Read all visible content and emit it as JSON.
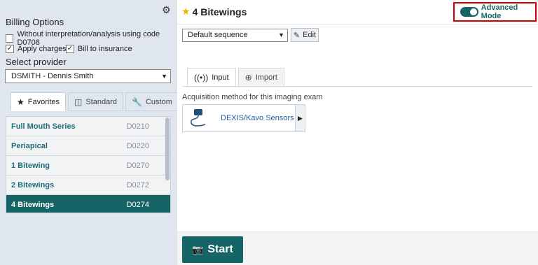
{
  "left": {
    "billing_title": "Billing Options",
    "no_interp_label": "Without interpretation/analysis using code D0708",
    "no_interp_checked": false,
    "apply_charges_label": "Apply charges",
    "apply_charges_checked": true,
    "bill_insurance_label": "Bill to insurance",
    "bill_insurance_checked": true,
    "select_provider_title": "Select provider",
    "provider_value": "DSMITH - Dennis Smith",
    "tabs": [
      {
        "label": "Favorites",
        "icon": "star-icon",
        "active": true
      },
      {
        "label": "Standard",
        "icon": "book-icon",
        "active": false
      },
      {
        "label": "Custom",
        "icon": "wrench-icon",
        "active": false
      }
    ],
    "items": [
      {
        "name": "Full Mouth Series",
        "code": "D0210"
      },
      {
        "name": "Periapical",
        "code": "D0220"
      },
      {
        "name": "1 Bitewing",
        "code": "D0270"
      },
      {
        "name": "2 Bitewings",
        "code": "D0272"
      },
      {
        "name": "4 Bitewings",
        "code": "D0274",
        "selected": true
      }
    ]
  },
  "right": {
    "title": "4 Bitewings",
    "advanced_mode_label": "Advanced Mode",
    "advanced_mode_on": true,
    "sequence_value": "Default sequence",
    "edit_label": "Edit",
    "tabs": [
      {
        "label": "Input",
        "icon": "radio-waves-icon",
        "active": true
      },
      {
        "label": "Import",
        "icon": "plus-circle-icon",
        "active": false
      }
    ],
    "acquisition_label": "Acquisition method for this imaging exam",
    "sensor_name": "DEXIS/Kavo Sensors",
    "start_label": "Start"
  },
  "colors": {
    "accent": "#166566",
    "highlight_border": "#d40000",
    "star": "#f0b400",
    "link_text": "#1f6c77"
  }
}
